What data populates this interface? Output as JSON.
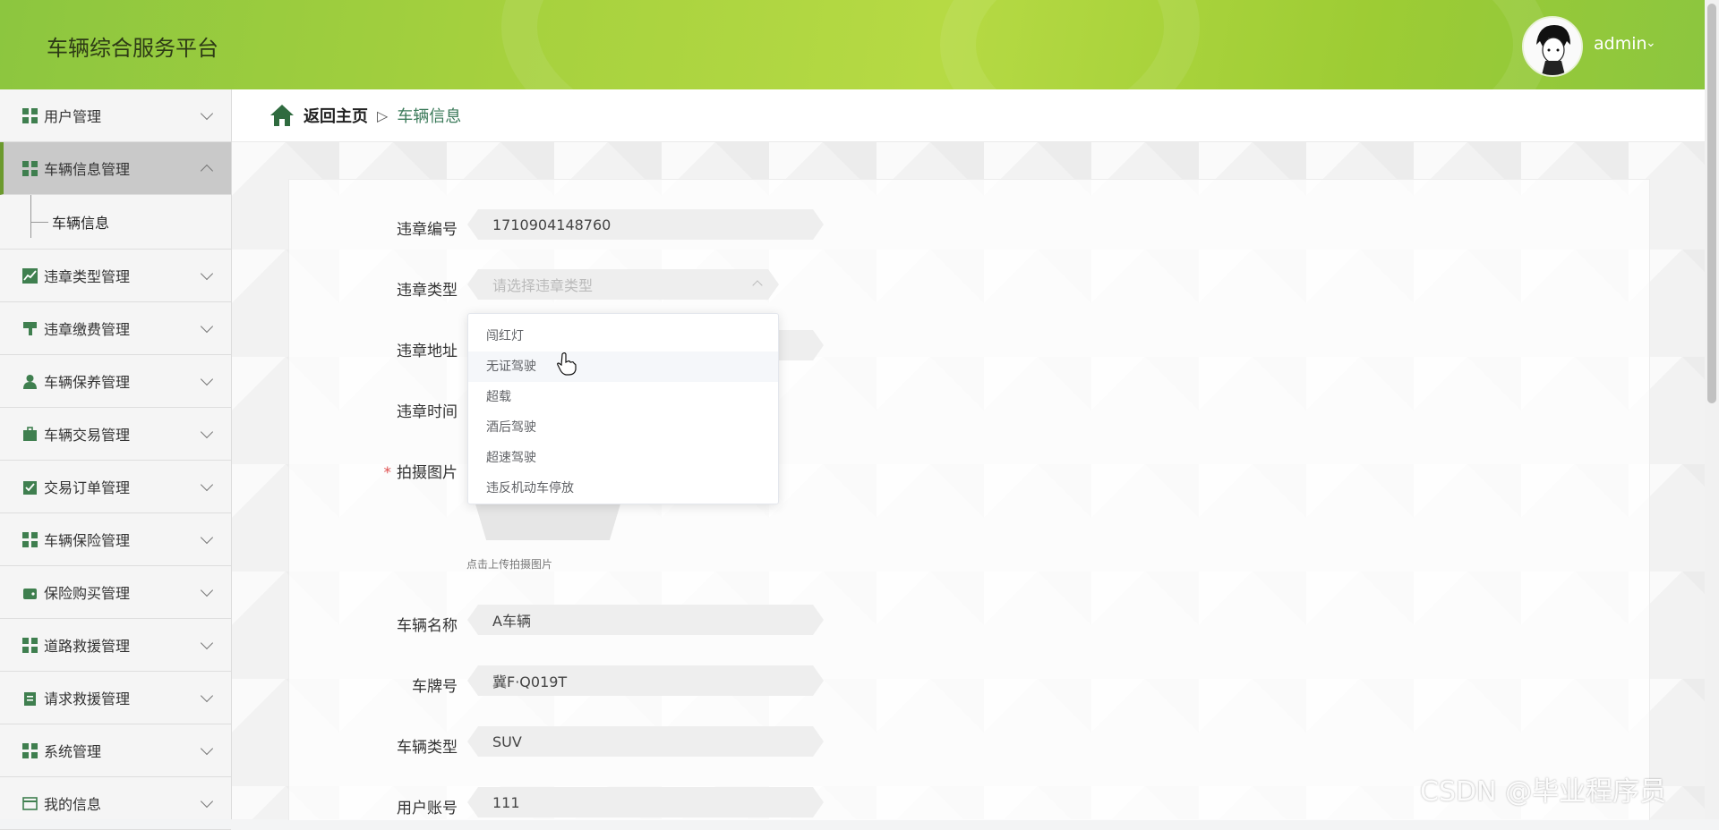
{
  "header": {
    "app_title": "车辆综合服务平台",
    "user_name": "admin",
    "user_caret": "⌄"
  },
  "sidebar": {
    "items": [
      {
        "label": "用户管理",
        "icon": "grid-icon"
      },
      {
        "label": "车辆信息管理",
        "icon": "grid-icon",
        "expanded": true
      },
      {
        "label": "违章类型管理",
        "icon": "chart-icon"
      },
      {
        "label": "违章缴费管理",
        "icon": "brush-icon"
      },
      {
        "label": "车辆保养管理",
        "icon": "person-icon"
      },
      {
        "label": "车辆交易管理",
        "icon": "briefcase-icon"
      },
      {
        "label": "交易订单管理",
        "icon": "clipboard-check-icon"
      },
      {
        "label": "车辆保险管理",
        "icon": "grid-icon"
      },
      {
        "label": "保险购买管理",
        "icon": "wallet-icon"
      },
      {
        "label": "道路救援管理",
        "icon": "grid-icon"
      },
      {
        "label": "请求救援管理",
        "icon": "clipboard-icon"
      },
      {
        "label": "系统管理",
        "icon": "grid-icon"
      },
      {
        "label": "我的信息",
        "icon": "card-icon"
      }
    ],
    "subitem": "车辆信息"
  },
  "breadcrumb": {
    "back": "返回主页",
    "separator": "▷",
    "current": "车辆信息"
  },
  "form": {
    "violation_no_label": "违章编号",
    "violation_no_value": "1710904148760",
    "violation_type_label": "违章类型",
    "violation_type_placeholder": "请选择违章类型",
    "violation_addr_label": "违章地址",
    "violation_time_label": "违章时间",
    "photo_label": "拍摄图片",
    "photo_required": "*",
    "upload_tip": "点击上传拍摄图片",
    "vehicle_name_label": "车辆名称",
    "vehicle_name_value": "A车辆",
    "plate_label": "车牌号",
    "plate_value": "冀F·Q019T",
    "vehicle_type_label": "车辆类型",
    "vehicle_type_value": "SUV",
    "account_label": "用户账号",
    "account_value": "111"
  },
  "dropdown": {
    "options": [
      "闯红灯",
      "无证驾驶",
      "超载",
      "酒后驾驶",
      "超速驾驶",
      "违反机动车停放"
    ],
    "hovered": "无证驾驶"
  },
  "watermark": "CSDN @毕业程序员",
  "colors": {
    "accent": "#9dcc34",
    "active_menu": "#c9c9c9",
    "link": "#3b7a5a"
  }
}
